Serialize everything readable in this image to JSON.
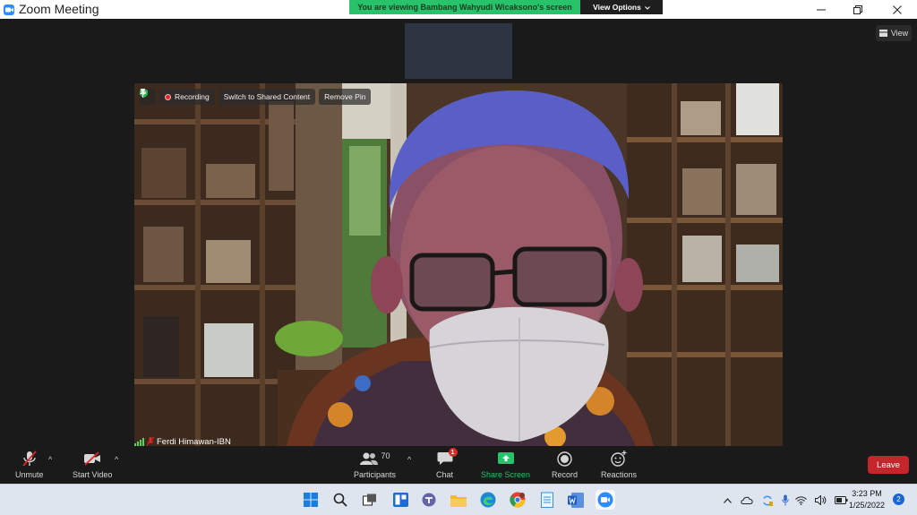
{
  "window": {
    "title": "Zoom Meeting",
    "share_banner": "You are viewing Bambang Wahyudi Wicaksono's screen",
    "view_options": "View Options"
  },
  "meeting": {
    "view_label": "View",
    "video_toolbar": {
      "recording": "Recording",
      "switch_shared": "Switch to Shared Content",
      "remove_pin": "Remove Pin"
    },
    "participant_name": "Ferdi Himawan-IBN"
  },
  "controls": {
    "unmute": "Unmute",
    "start_video": "Start Video",
    "participants": "Participants",
    "participants_count": "70",
    "chat": "Chat",
    "chat_badge": "1",
    "share_screen": "Share Screen",
    "record": "Record",
    "reactions": "Reactions",
    "leave": "Leave"
  },
  "taskbar": {
    "time": "3:23 PM",
    "date": "1/25/2022",
    "notifications": "2"
  },
  "colors": {
    "zoom_blue": "#2d8cff",
    "share_green": "#27c26a",
    "leave_red": "#c4262c",
    "mic_muted_red": "#e02828"
  },
  "icons": [
    "zoom-logo-icon",
    "chevron-down-icon",
    "minimize-icon",
    "restore-icon",
    "close-icon",
    "grid-icon",
    "shield-icon",
    "record-dot-icon",
    "pin-icon",
    "signal-icon",
    "mic-muted-icon",
    "video-off-icon",
    "participants-icon",
    "chat-icon",
    "share-screen-icon",
    "record-icon",
    "reactions-icon",
    "windows-start-icon",
    "search-icon",
    "task-view-icon",
    "widgets-icon",
    "teams-icon",
    "file-explorer-icon",
    "edge-icon",
    "chrome-icon",
    "notepad-icon",
    "word-icon",
    "zoom-icon",
    "chevron-up-icon",
    "cloud-icon",
    "sync-icon",
    "microphone-icon",
    "wifi-icon",
    "volume-icon",
    "battery-icon"
  ]
}
